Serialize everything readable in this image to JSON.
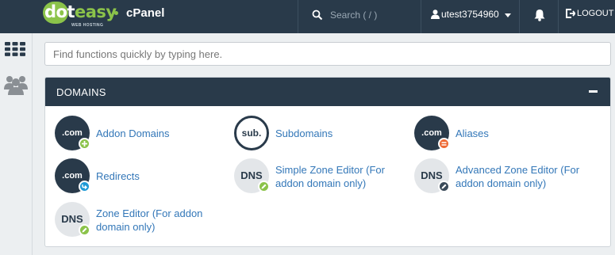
{
  "header": {
    "logo_text_a": "dot",
    "logo_text_b": "easy",
    "logo_sub": "WEB HOSTING",
    "brand": "cPanel",
    "search_placeholder": "Search ( / )",
    "username": "utest3754960",
    "logout_label": "LOGOUT"
  },
  "quickfind": {
    "placeholder": "Find functions quickly by typing here."
  },
  "panel": {
    "title": "DOMAINS",
    "items": [
      {
        "label": "Addon Domains",
        "icon_text": ".com"
      },
      {
        "label": "Subdomains",
        "icon_text": "sub."
      },
      {
        "label": "Aliases",
        "icon_text": ".com"
      },
      {
        "label": "Redirects",
        "icon_text": ".com"
      },
      {
        "label": "Simple Zone Editor (For addon domain only)",
        "icon_text": "DNS"
      },
      {
        "label": "Advanced Zone Editor (For addon domain only)",
        "icon_text": "DNS"
      },
      {
        "label": "Zone Editor (For addon domain only)",
        "icon_text": "DNS"
      }
    ]
  },
  "colors": {
    "navy": "#293a4a",
    "green": "#8bc34a",
    "link": "#3377b8",
    "orange": "#ee6a35",
    "blue_badge": "#1f9ad6",
    "dark_badge": "#3a4a59"
  }
}
